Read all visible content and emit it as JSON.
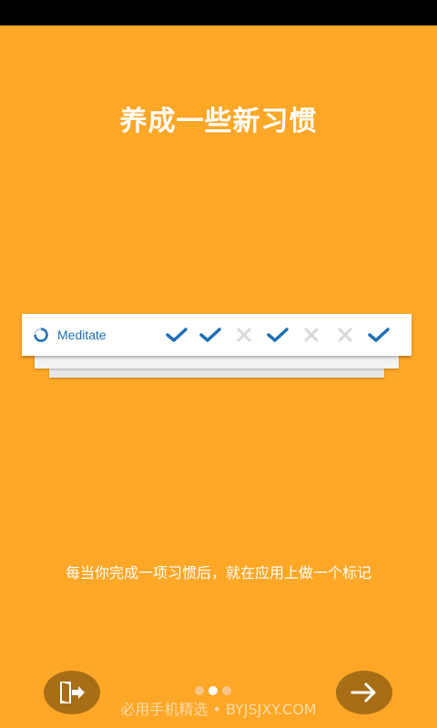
{
  "title": "养成一些新习惯",
  "habit": {
    "name": "Meditate",
    "icon": "ring-icon",
    "marks": [
      "check",
      "check",
      "cross",
      "check",
      "cross",
      "cross",
      "check"
    ]
  },
  "description": "每当你完成一项习惯后，就在应用上做一个标记",
  "pagination": {
    "count": 3,
    "active_index": 1
  },
  "buttons": {
    "skip_icon": "exit-door-icon",
    "next_icon": "arrow-right-icon"
  },
  "watermark": "必用手机精选 • BYJSJXY.COM",
  "colors": {
    "background": "#FFA726",
    "accent_blue": "#1E6FB5",
    "button": "#A86E16",
    "cross": "#D9D9D9"
  }
}
